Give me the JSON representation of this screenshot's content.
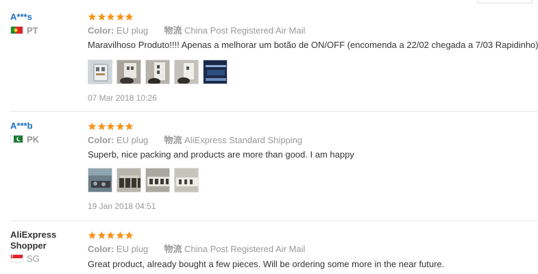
{
  "reviews": [
    {
      "user": "A***s",
      "country_code": "PT",
      "rating": 5,
      "color_label": "Color:",
      "color_value": "EU plug",
      "shipping_label": "物流",
      "shipping_value": "China Post Registered Air Mail",
      "text": "Maravilhoso Produto!!!! Apenas a melhorar um botão de ON/OFF (encomenda a 22/02 chegada a 7/03 Rapidinho)",
      "photos": 5,
      "date": "07 Mar 2018 10:26"
    },
    {
      "user": "A***b",
      "country_code": "PK",
      "rating": 5,
      "color_label": "Color:",
      "color_value": "EU plug",
      "shipping_label": "物流",
      "shipping_value": "AliExpress Standard Shipping",
      "text": "Superb, nice packing and products are more than good. I am happy",
      "photos": 4,
      "date": "19 Jan 2018 04:51"
    },
    {
      "user_line1": "AliExpress",
      "user_line2": "Shopper",
      "country_code": "SG",
      "rating": 5,
      "color_label": "Color:",
      "color_value": "EU plug",
      "shipping_label": "物流",
      "shipping_value": "China Post Registered Air Mail",
      "text": "Great product, already bought a few pieces. Will be ordering some more in the near future."
    }
  ],
  "colors": {
    "star": "#f7941d",
    "username": "#1a6ec3",
    "muted": "#999999",
    "separator": "#e8e8e8"
  },
  "icons": [
    "star-icon",
    "flag-pt-icon",
    "flag-pk-icon",
    "flag-sg-icon",
    "review-photo-thumbnail"
  ]
}
